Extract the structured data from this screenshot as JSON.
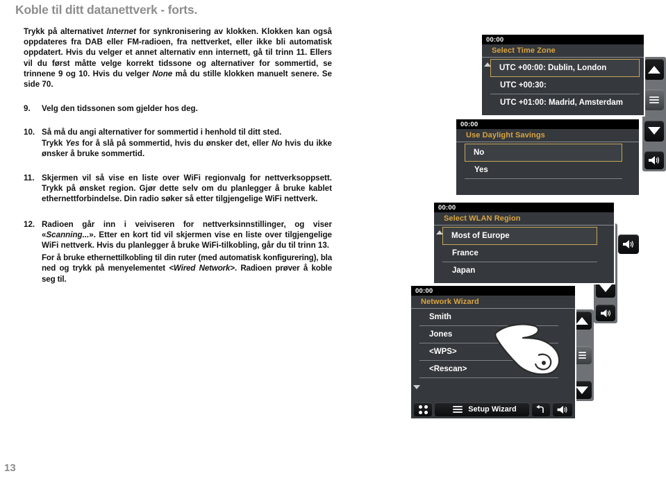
{
  "document": {
    "heading": "Koble til ditt datanettverk - forts.",
    "page_number": "13"
  },
  "body": {
    "intro": {
      "before_internet": "Trykk på alternativet ",
      "internet": "Internet",
      "after_internet": " for synkronisering av klokken. Klokken kan også oppdateres fra DAB eller FM-radioen, fra nettverket, eller ikke bli automatisk oppdatert. Hvis du velger et annet alternativ enn internett, gå til trinn 11. Ellers vil du først måtte velge korrekt tidssone og alternativer for sommertid, se trinnene 9 og 10. Hvis du velger ",
      "none": "None",
      "tail": " må du stille klokken manuelt senere. Se side 70."
    },
    "steps": [
      {
        "number": "9.",
        "lines": [
          {
            "text": "Velg den tidssonen som gjelder hos deg."
          }
        ]
      },
      {
        "number": "10.",
        "lines": [
          {
            "text": "Så må du angi alternativer for sommertid i henhold til ditt sted."
          },
          {
            "pre": "Trykk ",
            "b1": "Yes",
            "mid": " for å slå på sommertid, hvis du ønsker det, eller ",
            "b2": "No",
            "post": " hvis du ikke ønsker å bruke sommertid."
          }
        ]
      },
      {
        "number": "11.",
        "lines": [
          {
            "text": "Skjermen vil så vise en liste over WiFi regionvalg for nettverksoppsett. Trykk på ønsket region. Gjør dette selv om du planlegger å bruke kablet ethernettforbindelse. Din radio søker så etter tilgjengelige WiFi nettverk."
          }
        ]
      },
      {
        "number": "12.",
        "lines": [
          {
            "pre": "Radioen går inn i veiviseren for nettverksinnstillinger, og viser «",
            "i1": "Scanning...",
            "post": "». Etter en kort tid vil skjermen vise en liste over tilgjengelige WiFi nettverk. Hvis du planlegger å bruke WiFi-tilkobling, går du til trinn 13."
          },
          {
            "pre": "For å bruke ethernettilkobling til din ruter (med automatisk konfigurering), bla ned og trykk på menyelementet ",
            "b1": "<Wired Network>",
            "post": ". Radioen prøver å koble seg til."
          }
        ]
      }
    ]
  },
  "screens": {
    "time_zone": {
      "clock": "00:00",
      "title": "Select Time Zone",
      "items": [
        {
          "label": "UTC +00:00: Dublin, London",
          "selected": true
        },
        {
          "label": "UTC +00:30:",
          "selected": false
        },
        {
          "label": "UTC +01:00: Madrid, Amsterdam",
          "selected": false
        }
      ]
    },
    "daylight_savings": {
      "clock": "00:00",
      "title": "Use Daylight Savings",
      "items": [
        {
          "label": "No",
          "selected": true
        },
        {
          "label": "Yes",
          "selected": false
        }
      ]
    },
    "wlan_region": {
      "clock": "00:00",
      "title": "Select WLAN Region",
      "items": [
        {
          "label": "Most of Europe",
          "selected": true
        },
        {
          "label": "France",
          "selected": false
        },
        {
          "label": "Japan",
          "selected": false
        }
      ]
    },
    "network_wizard": {
      "clock": "00:00",
      "title": "Network Wizard",
      "items": [
        {
          "label": "Smith",
          "selected": false
        },
        {
          "label": "Jones",
          "selected": false
        },
        {
          "label": "<WPS>",
          "selected": false
        },
        {
          "label": "<Rescan>",
          "selected": false
        }
      ],
      "chevron": ">",
      "bottom_bar": {
        "menu_label": "Setup Wizard"
      }
    }
  },
  "colors": {
    "screen_bg": "#35383c",
    "title_gold": "#d9a441",
    "selection_border": "#c9a659",
    "time_bar": "#000000",
    "heading_gray": "#8d8d8d",
    "button_column": "#6e7276"
  }
}
